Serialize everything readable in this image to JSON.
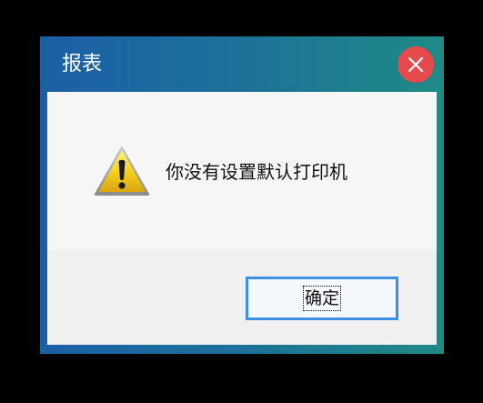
{
  "dialog": {
    "title": "报表",
    "message": "你没有设置默认打印机",
    "ok_label": "确定",
    "icon": "warning-icon",
    "close_icon": "close-icon"
  },
  "colors": {
    "titlebar_start": "#1b5fa6",
    "titlebar_end": "#1f8a86",
    "close_button": "#e64a4a",
    "focus_border": "#3b8fe6"
  }
}
